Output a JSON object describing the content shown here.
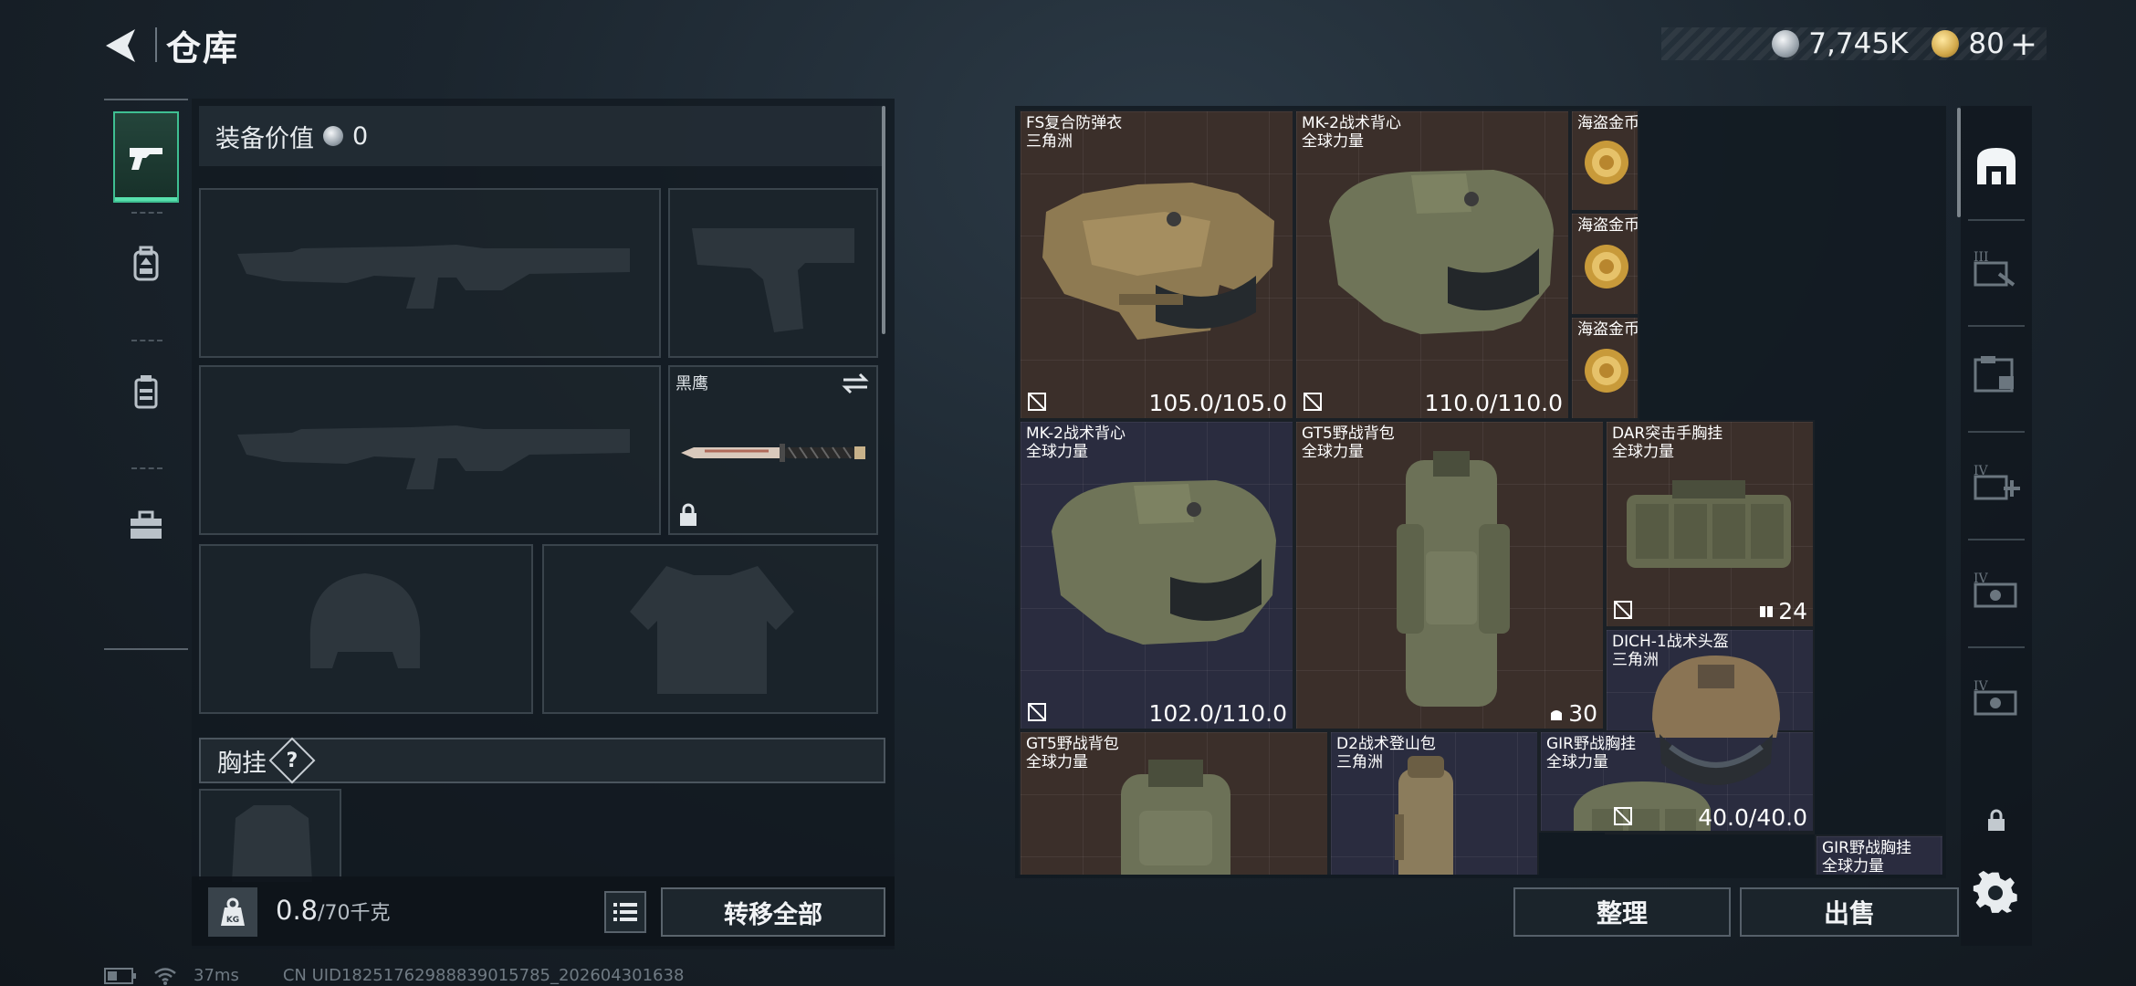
{
  "header": {
    "title": "仓库"
  },
  "currency": {
    "coin_value": "7,745K",
    "gold_value": "80",
    "add_label": "+"
  },
  "equipment": {
    "value_label": "装备价值",
    "value": "0",
    "melee_name": "黑鹰",
    "chest_rig_label": "胸挂",
    "help_label": "?"
  },
  "weight": {
    "current": "0.8",
    "max_label": "/70千克",
    "kg_label": "KG"
  },
  "buttons": {
    "transfer_all": "转移全部",
    "organize": "整理",
    "sell": "出售"
  },
  "storage_items": [
    {
      "name": "FS复合防弹衣",
      "origin": "三角洲",
      "durability": "105.0/105.0"
    },
    {
      "name": "MK-2战术背心",
      "origin": "全球力量",
      "durability": "110.0/110.0"
    },
    {
      "name": "海盗金币"
    },
    {
      "name": "海盗金币"
    },
    {
      "name": "海盗金币"
    },
    {
      "name": "MK-2战术背心",
      "origin": "全球力量",
      "durability": "102.0/110.0"
    },
    {
      "name": "GT5野战背包",
      "origin": "全球力量",
      "count": "30"
    },
    {
      "name": "DAR突击手胸挂",
      "origin": "全球力量",
      "count": "24"
    },
    {
      "name": "DICH-1战术头盔",
      "origin": "三角洲",
      "durability": "40.0/40.0"
    },
    {
      "name": "GT5野战背包",
      "origin": "全球力量"
    },
    {
      "name": "D2战术登山包",
      "origin": "三角洲"
    },
    {
      "name": "GIR野战胸挂",
      "origin": "全球力量"
    },
    {
      "name": "GIR野战胸挂",
      "origin": "全球力量"
    }
  ],
  "status_bar": {
    "ping": "37ms",
    "uid": "CN UID18251762988839015785_202604301638"
  },
  "colors": {
    "accent_green": "#3fbf92",
    "cell_brown": "#3b2f2a",
    "cell_navy": "#2a2c3f"
  }
}
